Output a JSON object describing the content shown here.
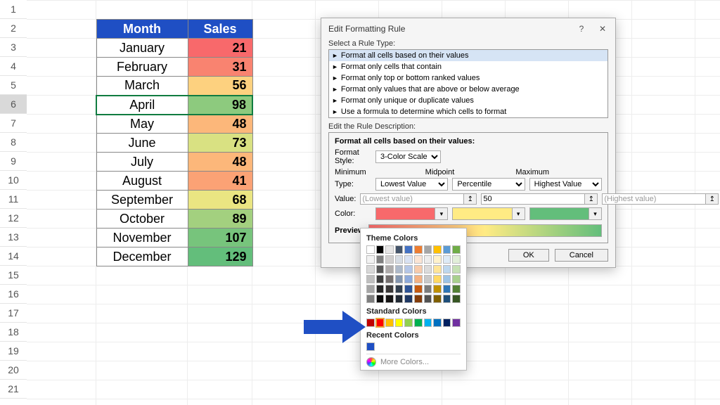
{
  "row_headers": [
    "1",
    "2",
    "3",
    "4",
    "5",
    "6",
    "7",
    "8",
    "9",
    "10",
    "11",
    "12",
    "13",
    "14",
    "15",
    "16",
    "17",
    "18",
    "19",
    "20",
    "21"
  ],
  "selected_row_index": 5,
  "table": {
    "headers": [
      "Month",
      "Sales"
    ],
    "rows": [
      {
        "month": "January",
        "sales": 21,
        "color": "#f8696b"
      },
      {
        "month": "February",
        "sales": 31,
        "color": "#f98370"
      },
      {
        "month": "March",
        "sales": 56,
        "color": "#fdd17f"
      },
      {
        "month": "April",
        "sales": 98,
        "color": "#8dca7e"
      },
      {
        "month": "May",
        "sales": 48,
        "color": "#fcb77a"
      },
      {
        "month": "June",
        "sales": 73,
        "color": "#d9e182"
      },
      {
        "month": "July",
        "sales": 48,
        "color": "#fcb77a"
      },
      {
        "month": "August",
        "sales": 41,
        "color": "#fba275"
      },
      {
        "month": "September",
        "sales": 68,
        "color": "#eae582"
      },
      {
        "month": "October",
        "sales": 89,
        "color": "#a3d07f"
      },
      {
        "month": "November",
        "sales": 107,
        "color": "#77c47c"
      },
      {
        "month": "December",
        "sales": 129,
        "color": "#63be7b"
      }
    ]
  },
  "dialog": {
    "title": "Edit Formatting Rule",
    "select_rule_label": "Select a Rule Type:",
    "rule_types": [
      "Format all cells based on their values",
      "Format only cells that contain",
      "Format only top or bottom ranked values",
      "Format only values that are above or below average",
      "Format only unique or duplicate values",
      "Use a formula to determine which cells to format"
    ],
    "selected_rule_index": 0,
    "edit_desc_label": "Edit the Rule Description:",
    "desc_title": "Format all cells based on their values:",
    "format_style_label": "Format Style:",
    "format_style_value": "3-Color Scale",
    "cols": {
      "minimum": {
        "header": "Minimum",
        "type_label": "Type:",
        "type": "Lowest Value",
        "value_label": "Value:",
        "value": "(Lowest value)",
        "color_label": "Color:",
        "color": "#f8696b"
      },
      "midpoint": {
        "header": "Midpoint",
        "type": "Percentile",
        "value": "50",
        "color": "#ffeb84"
      },
      "maximum": {
        "header": "Maximum",
        "type": "Highest Value",
        "value": "(Highest value)",
        "color": "#63be7b"
      }
    },
    "preview_label": "Preview",
    "ok_label": "OK",
    "cancel_label": "Cancel"
  },
  "colorpicker": {
    "theme_label": "Theme Colors",
    "theme_row": [
      "#ffffff",
      "#000000",
      "#e7e6e6",
      "#44546a",
      "#4472c4",
      "#ed7d31",
      "#a5a5a5",
      "#ffc000",
      "#5b9bd5",
      "#70ad47"
    ],
    "theme_shades": [
      [
        "#f2f2f2",
        "#7f7f7f",
        "#d0cece",
        "#d6dce4",
        "#d9e2f3",
        "#fbe5d5",
        "#ededed",
        "#fff2cc",
        "#deebf6",
        "#e2efd9"
      ],
      [
        "#d8d8d8",
        "#595959",
        "#aeabab",
        "#adb9ca",
        "#b4c6e7",
        "#f7cbac",
        "#dbdbdb",
        "#fee599",
        "#bdd7ee",
        "#c5e0b3"
      ],
      [
        "#bfbfbf",
        "#3f3f3f",
        "#757070",
        "#8496b0",
        "#8eaadb",
        "#f4b183",
        "#c9c9c9",
        "#ffd965",
        "#9cc3e5",
        "#a8d08d"
      ],
      [
        "#a5a5a5",
        "#262626",
        "#3a3838",
        "#323f4f",
        "#2f5496",
        "#c55a11",
        "#7b7b7b",
        "#bf9000",
        "#2e75b5",
        "#538135"
      ],
      [
        "#7f7f7f",
        "#0c0c0c",
        "#171616",
        "#222a35",
        "#1f3864",
        "#833c0b",
        "#525252",
        "#7f6000",
        "#1e4e79",
        "#375623"
      ]
    ],
    "standard_label": "Standard Colors",
    "standard": [
      "#c00000",
      "#ff0000",
      "#ffc000",
      "#ffff00",
      "#92d050",
      "#00b050",
      "#00b0f0",
      "#0070c0",
      "#002060",
      "#7030a0"
    ],
    "standard_selected_index": 1,
    "recent_label": "Recent Colors",
    "recent": [
      "#1f4fc4"
    ],
    "more_label": "More Colors..."
  }
}
